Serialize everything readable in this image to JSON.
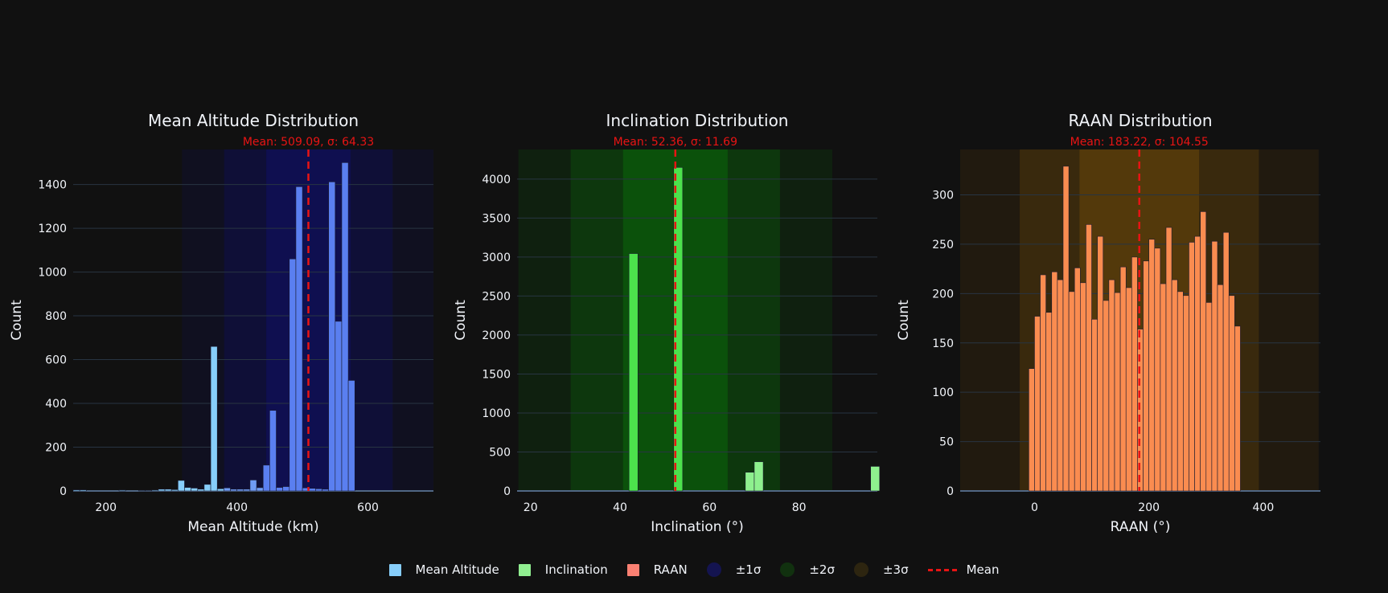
{
  "chart_data": [
    {
      "type": "bar",
      "title": "Mean Altitude Distribution",
      "annotation": "Mean: 509.09, σ: 64.33",
      "xlabel": "Mean Altitude (km)",
      "ylabel": "Count",
      "xlim": [
        150,
        700
      ],
      "ylim": [
        0,
        1560
      ],
      "xticks": [
        200,
        400,
        600
      ],
      "yticks": [
        0,
        200,
        400,
        600,
        800,
        1000,
        1200,
        1400
      ],
      "mean": 509.09,
      "sigma": 64.33,
      "bin_width": 10,
      "band_color": "#10106a",
      "bars": [
        {
          "x": 155,
          "y": 5,
          "c": "#87cefa"
        },
        {
          "x": 165,
          "y": 5,
          "c": "#87cefa"
        },
        {
          "x": 225,
          "y": 4,
          "c": "#87cefa"
        },
        {
          "x": 255,
          "y": 3,
          "c": "#87cefa"
        },
        {
          "x": 265,
          "y": 3,
          "c": "#87cefa"
        },
        {
          "x": 275,
          "y": 4,
          "c": "#87cefa"
        },
        {
          "x": 285,
          "y": 8,
          "c": "#87cefa"
        },
        {
          "x": 295,
          "y": 8,
          "c": "#87cefa"
        },
        {
          "x": 305,
          "y": 6,
          "c": "#87cefa"
        },
        {
          "x": 315,
          "y": 48,
          "c": "#87cefa"
        },
        {
          "x": 325,
          "y": 16,
          "c": "#87cefa"
        },
        {
          "x": 335,
          "y": 13,
          "c": "#87cefa"
        },
        {
          "x": 345,
          "y": 8,
          "c": "#87cefa"
        },
        {
          "x": 355,
          "y": 30,
          "c": "#87cefa"
        },
        {
          "x": 365,
          "y": 660,
          "c": "#87cefa"
        },
        {
          "x": 375,
          "y": 10,
          "c": "#87cefa"
        },
        {
          "x": 385,
          "y": 14,
          "c": "#6f9cf4"
        },
        {
          "x": 395,
          "y": 8,
          "c": "#6f9cf4"
        },
        {
          "x": 405,
          "y": 8,
          "c": "#6f9cf4"
        },
        {
          "x": 415,
          "y": 8,
          "c": "#6f9cf4"
        },
        {
          "x": 425,
          "y": 50,
          "c": "#6f9cf4"
        },
        {
          "x": 435,
          "y": 15,
          "c": "#6f9cf4"
        },
        {
          "x": 445,
          "y": 118,
          "c": "#5a7ff0"
        },
        {
          "x": 455,
          "y": 368,
          "c": "#5a7ff0"
        },
        {
          "x": 465,
          "y": 16,
          "c": "#5a7ff0"
        },
        {
          "x": 475,
          "y": 20,
          "c": "#5a7ff0"
        },
        {
          "x": 485,
          "y": 1060,
          "c": "#5a7ff0"
        },
        {
          "x": 495,
          "y": 1390,
          "c": "#5a7ff0"
        },
        {
          "x": 505,
          "y": 14,
          "c": "#5a7ff0"
        },
        {
          "x": 515,
          "y": 12,
          "c": "#5a7ff0"
        },
        {
          "x": 525,
          "y": 10,
          "c": "#5a7ff0"
        },
        {
          "x": 535,
          "y": 8,
          "c": "#5a7ff0"
        },
        {
          "x": 545,
          "y": 1412,
          "c": "#5a7ff0"
        },
        {
          "x": 555,
          "y": 775,
          "c": "#5a7ff0"
        },
        {
          "x": 565,
          "y": 1500,
          "c": "#5a7ff0"
        },
        {
          "x": 575,
          "y": 505,
          "c": "#5a7ff0"
        }
      ]
    },
    {
      "type": "bar",
      "title": "Inclination Distribution",
      "annotation": "Mean: 52.36, σ: 11.69",
      "xlabel": "Inclination (°)",
      "ylabel": "Count",
      "xlim": [
        17,
        97.5
      ],
      "ylim": [
        0,
        4380
      ],
      "xticks": [
        20,
        40,
        60,
        80
      ],
      "yticks": [
        0,
        500,
        1000,
        1500,
        2000,
        2500,
        3000,
        3500,
        4000
      ],
      "mean": 52.36,
      "sigma": 11.69,
      "bin_width": 2,
      "band_color": "#0a6b0a",
      "bars": [
        {
          "x": 43,
          "y": 3045,
          "c": "#4ce24c"
        },
        {
          "x": 53,
          "y": 4150,
          "c": "#4ce24c"
        },
        {
          "x": 69,
          "y": 240,
          "c": "#8ef08e"
        },
        {
          "x": 71,
          "y": 375,
          "c": "#8ef08e"
        },
        {
          "x": 97,
          "y": 315,
          "c": "#8ef08e"
        }
      ]
    },
    {
      "type": "bar",
      "title": "RAAN Distribution",
      "annotation": "Mean: 183.22, σ: 104.55",
      "xlabel": "RAAN (°)",
      "ylabel": "Count",
      "xlim": [
        -130,
        500
      ],
      "ylim": [
        0,
        346
      ],
      "xticks": [
        0,
        200,
        400
      ],
      "yticks": [
        0,
        50,
        100,
        150,
        200,
        250,
        300
      ],
      "mean": 183.22,
      "sigma": 104.55,
      "bin_width": 10,
      "band_color": "#6e4a0a",
      "bars": [
        {
          "x": -5,
          "y": 124,
          "c": "#fa8c50"
        },
        {
          "x": 5,
          "y": 177,
          "c": "#fa8c50"
        },
        {
          "x": 15,
          "y": 219,
          "c": "#fa8c50"
        },
        {
          "x": 25,
          "y": 181,
          "c": "#fa8c50"
        },
        {
          "x": 35,
          "y": 222,
          "c": "#fa8c50"
        },
        {
          "x": 45,
          "y": 214,
          "c": "#fa8c50"
        },
        {
          "x": 55,
          "y": 329,
          "c": "#fa8c50"
        },
        {
          "x": 65,
          "y": 202,
          "c": "#fa8c50"
        },
        {
          "x": 75,
          "y": 226,
          "c": "#fa8c50"
        },
        {
          "x": 85,
          "y": 211,
          "c": "#fa8c50"
        },
        {
          "x": 95,
          "y": 270,
          "c": "#fa8c50"
        },
        {
          "x": 105,
          "y": 174,
          "c": "#fa8c50"
        },
        {
          "x": 115,
          "y": 258,
          "c": "#fa8c50"
        },
        {
          "x": 125,
          "y": 193,
          "c": "#fa8c50"
        },
        {
          "x": 135,
          "y": 214,
          "c": "#fa8c50"
        },
        {
          "x": 145,
          "y": 201,
          "c": "#fa8c50"
        },
        {
          "x": 155,
          "y": 227,
          "c": "#fa8c50"
        },
        {
          "x": 165,
          "y": 206,
          "c": "#fa8c50"
        },
        {
          "x": 175,
          "y": 237,
          "c": "#fa8c50"
        },
        {
          "x": 185,
          "y": 164,
          "c": "#fa8c50"
        },
        {
          "x": 195,
          "y": 233,
          "c": "#fa8c50"
        },
        {
          "x": 205,
          "y": 255,
          "c": "#fa8c50"
        },
        {
          "x": 215,
          "y": 246,
          "c": "#fa8c50"
        },
        {
          "x": 225,
          "y": 210,
          "c": "#fa8c50"
        },
        {
          "x": 235,
          "y": 267,
          "c": "#fa8c50"
        },
        {
          "x": 245,
          "y": 214,
          "c": "#fa8c50"
        },
        {
          "x": 255,
          "y": 202,
          "c": "#fa8c50"
        },
        {
          "x": 265,
          "y": 198,
          "c": "#fa8c50"
        },
        {
          "x": 275,
          "y": 252,
          "c": "#fa8c50"
        },
        {
          "x": 285,
          "y": 258,
          "c": "#fa8c50"
        },
        {
          "x": 295,
          "y": 283,
          "c": "#fa8c50"
        },
        {
          "x": 305,
          "y": 191,
          "c": "#fa8c50"
        },
        {
          "x": 315,
          "y": 253,
          "c": "#fa8c50"
        },
        {
          "x": 325,
          "y": 209,
          "c": "#fa8c50"
        },
        {
          "x": 335,
          "y": 262,
          "c": "#fa8c50"
        },
        {
          "x": 345,
          "y": 198,
          "c": "#fa8c50"
        },
        {
          "x": 355,
          "y": 167,
          "c": "#fa8c50"
        }
      ]
    }
  ],
  "legend": {
    "items": [
      {
        "label": "Mean Altitude",
        "color": "#87cefa",
        "kind": "square"
      },
      {
        "label": "Inclination",
        "color": "#90ee90",
        "kind": "square"
      },
      {
        "label": "RAAN",
        "color": "#fa8072",
        "kind": "square"
      },
      {
        "label": "±1σ",
        "color": "#141450",
        "kind": "circle"
      },
      {
        "label": "±2σ",
        "color": "#11310f",
        "kind": "circle"
      },
      {
        "label": "±3σ",
        "color": "#2d2510",
        "kind": "circle"
      },
      {
        "label": "Mean",
        "color": "#e81414",
        "kind": "dash"
      }
    ]
  },
  "colors": {
    "background": "#111111",
    "grid": "#283442",
    "mean_line": "#e81414",
    "annotation": "#e81414"
  }
}
